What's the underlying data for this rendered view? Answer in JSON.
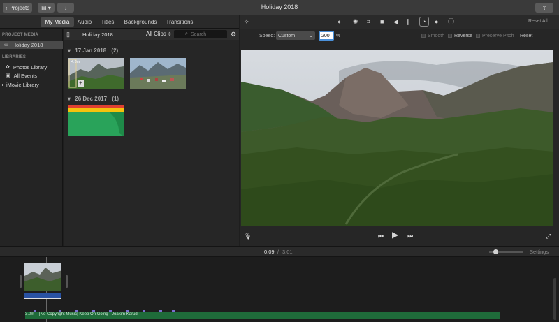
{
  "titlebar": {
    "projects_label": "Projects",
    "title": "Holiday 2018"
  },
  "tabs": [
    {
      "label": "My Media"
    },
    {
      "label": "Audio"
    },
    {
      "label": "Titles"
    },
    {
      "label": "Backgrounds"
    },
    {
      "label": "Transitions"
    }
  ],
  "sidebar": {
    "project_media_header": "PROJECT MEDIA",
    "project_item": "Holiday 2018",
    "libraries_header": "LIBRARIES",
    "items": [
      {
        "label": "Photos Library"
      },
      {
        "label": "All Events"
      },
      {
        "label": "iMovie Library"
      }
    ]
  },
  "browser": {
    "library_title": "Holiday 2018",
    "filter_label": "All Clips",
    "search_placeholder": "Search",
    "groups": [
      {
        "date": "17 Jan 2018",
        "count": "(2)",
        "clip_duration": "4.3m"
      },
      {
        "date": "26 Dec 2017",
        "count": "(1)"
      }
    ]
  },
  "viewer": {
    "reset_all_label": "Reset All",
    "speed_label": "Speed:",
    "speed_mode": "Custom",
    "speed_value": "200",
    "percent_sign": "%",
    "smooth_label": "Smooth",
    "reverse_label": "Reverse",
    "preserve_pitch_label": "Preserve Pitch",
    "reset_label": "Reset"
  },
  "timeline": {
    "current_time": "0:09",
    "separator": "/",
    "total_time": "3:01",
    "settings_label": "Settings",
    "audio_track_label": "3.0m – [No Copyright Music] Keep On Going - Joakim Karud"
  },
  "colors": {
    "accent": "#4a90d9",
    "audio_track": "#1f6b3a",
    "timeline_clip_audio": "#2952a3",
    "thumb_green": "#29a35a",
    "thumb_yellow": "#f4c20d",
    "thumb_red": "#e04030"
  }
}
